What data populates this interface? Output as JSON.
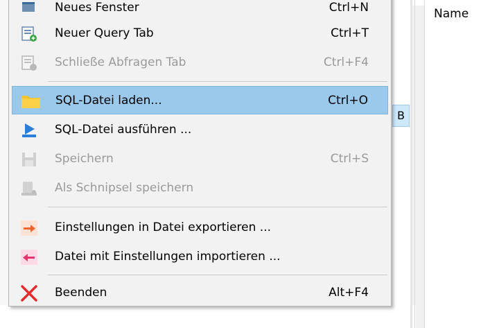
{
  "right_panel": {
    "column_header": "Name"
  },
  "partial_tab": {
    "label": "B"
  },
  "menu": {
    "items": [
      {
        "label": "Neues Fenster",
        "shortcut": "Ctrl+N",
        "icon": "new-window-icon",
        "disabled": false
      },
      {
        "label": "Neuer Query Tab",
        "shortcut": "Ctrl+T",
        "icon": "new-query-tab-icon",
        "disabled": false
      },
      {
        "label": "Schließe Abfragen Tab",
        "shortcut": "Ctrl+F4",
        "icon": "close-query-tab-icon",
        "disabled": true
      },
      {
        "label": "SQL-Datei laden...",
        "shortcut": "Ctrl+O",
        "icon": "folder-icon",
        "disabled": false,
        "highlighted": true
      },
      {
        "label": "SQL-Datei ausführen ...",
        "shortcut": "",
        "icon": "run-file-icon",
        "disabled": false
      },
      {
        "label": "Speichern",
        "shortcut": "Ctrl+S",
        "icon": "save-icon",
        "disabled": true
      },
      {
        "label": "Als Schnipsel speichern",
        "shortcut": "",
        "icon": "save-snippet-icon",
        "disabled": true
      },
      {
        "label": "Einstellungen in Datei exportieren ...",
        "shortcut": "",
        "icon": "export-arrow-icon",
        "disabled": false
      },
      {
        "label": "Datei mit Einstellungen importieren ...",
        "shortcut": "",
        "icon": "import-arrow-icon",
        "disabled": false
      },
      {
        "label": "Beenden",
        "shortcut": "Alt+F4",
        "icon": "close-x-icon",
        "disabled": false
      }
    ]
  },
  "colors": {
    "highlight": "#9bc9ec",
    "folder": "#f7c22e",
    "export_arrow": "#f2622c",
    "import_arrow": "#e8336d",
    "exit_x": "#e52b2b",
    "run_blue": "#2a7fd8"
  }
}
